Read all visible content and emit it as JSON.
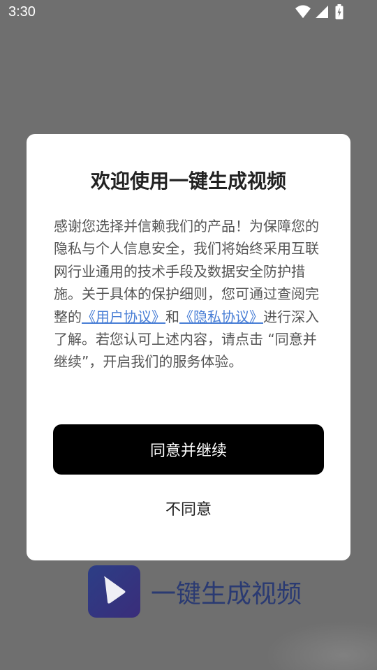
{
  "status_bar": {
    "time": "3:30"
  },
  "background": {
    "app_name": "一键生成视频",
    "logo_icon": "play-icon"
  },
  "dialog": {
    "title": "欢迎使用一键生成视频",
    "body": {
      "text_1": "感谢您选择并信赖我们的产品！为保障您的隐私与个人信息安全，我们将始终采用互联网行业通用的技术手段及数据安全防护措施。关于具体的保护细则，您可通过查阅完整的",
      "user_agreement_link": "《用户协议》",
      "text_2": "和",
      "privacy_link": "《隐私协议》",
      "text_3": "进行深入了解。若您认可上述内容，请点击 “同意并继续”，开启我们的服务体验。"
    },
    "agree_label": "同意并继续",
    "disagree_label": "不同意"
  },
  "colors": {
    "overlay": "#6f6f6f",
    "link": "#4a7fd6",
    "primary_button": "#000000"
  }
}
